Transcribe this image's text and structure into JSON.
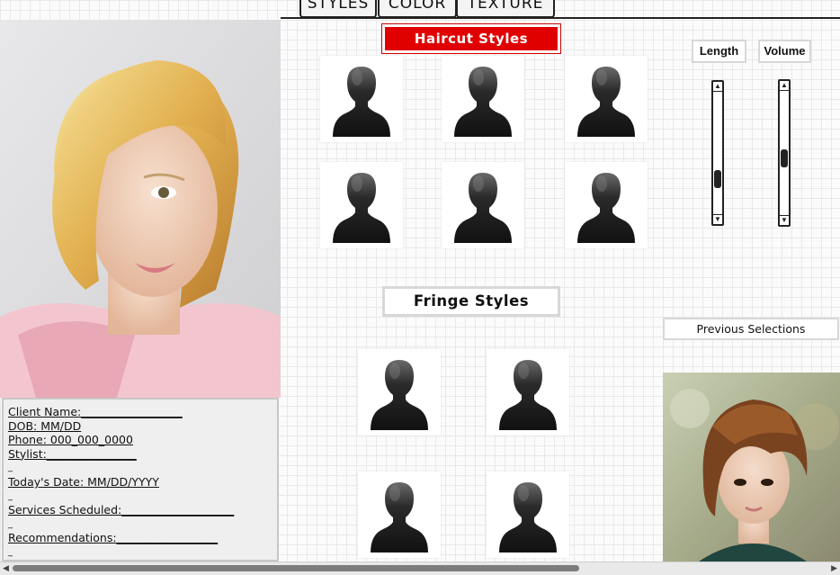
{
  "tabs": [
    "STYLES",
    "COLOR",
    "TEXTURE"
  ],
  "haircut": {
    "title": "Haircut Styles"
  },
  "fringe": {
    "title": "Fringe Styles"
  },
  "controls": {
    "length": {
      "label": "Length",
      "level": 0.75
    },
    "volume": {
      "label": "Volume",
      "level": 0.55
    }
  },
  "previous_selections_label": "Previous Selections",
  "client_form": {
    "name": "Client Name:__________________",
    "dob": "DOB: MM/DD",
    "phone": "Phone: 000_000_0000",
    "stylist": "Stylist:________________",
    "todays_date": "Today's Date: MM/DD/YYYY",
    "services": "Services Scheduled:____________________",
    "recommendations": "Recommendations:__________________",
    "blank": "_"
  },
  "icons": {
    "style_thumb": "person-silhouette-icon",
    "scroll_up": "arrow-up-icon",
    "scroll_down": "arrow-down-icon",
    "scroll_left": "arrow-left-icon",
    "scroll_right": "arrow-right-icon"
  },
  "colors": {
    "accent": "#e00000",
    "ink": "#222222",
    "panel": "#efefef"
  }
}
